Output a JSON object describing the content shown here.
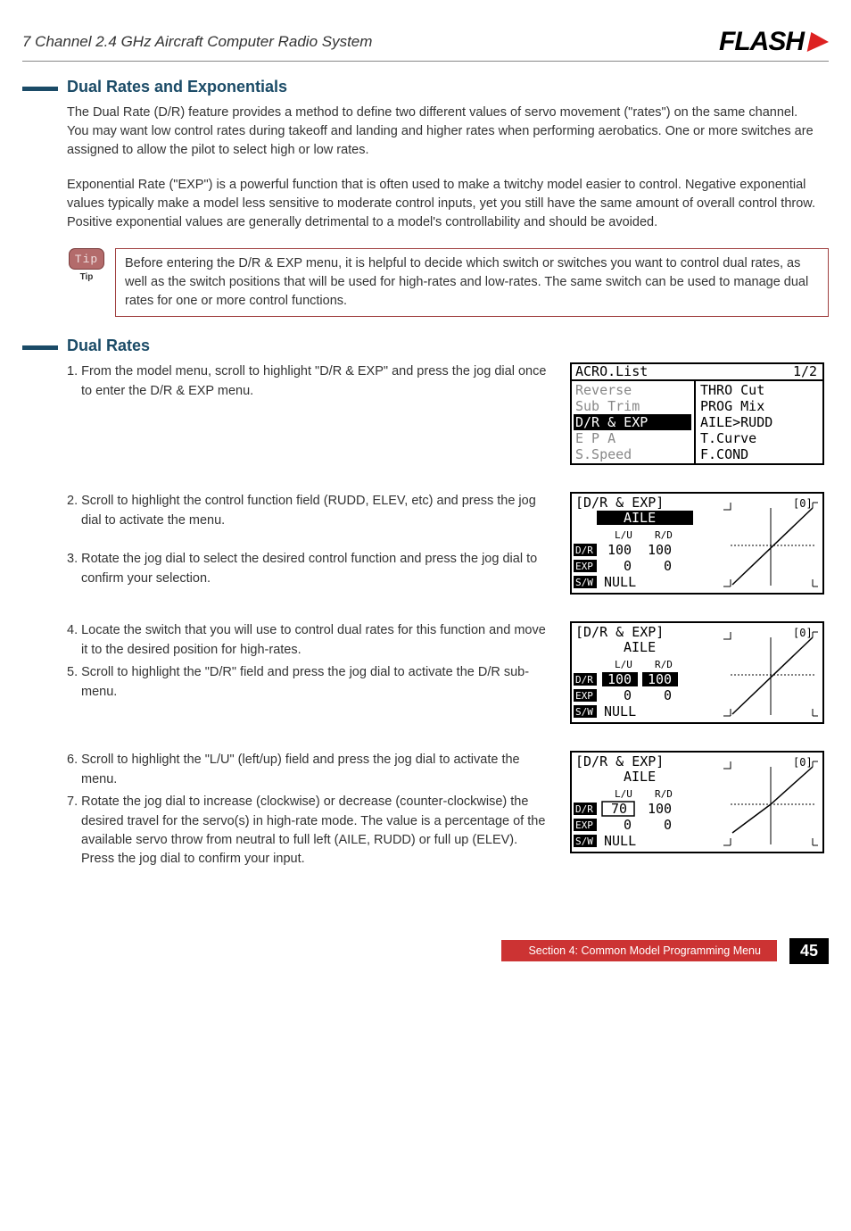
{
  "header": {
    "title": "7 Channel 2.4 GHz Aircraft Computer Radio System",
    "logo_text": "FLASH"
  },
  "section1": {
    "heading": "Dual Rates and Exponentials",
    "para1": "The Dual Rate (D/R) feature provides a method to define two different values of servo movement (\"rates\") on the same channel. You may want low control rates during takeoff and landing and higher rates when performing aerobatics. One or more switches are assigned to allow the pilot to select high or low rates.",
    "para2": "Exponential Rate (\"EXP\") is a powerful function that is often used to make a twitchy model easier to control. Negative exponential values typically make a model less sensitive to moderate control inputs, yet you still have the same amount of overall control throw. Positive exponential values are generally detrimental to a model's controllability and should be avoided."
  },
  "tip": {
    "badge": "Tip",
    "label": "Tip",
    "text": "Before entering the D/R & EXP menu, it is helpful to decide which switch or switches you want to control dual rates, as well as the switch positions that will be used for high-rates and low-rates. The same switch can be used to manage dual rates for one or more control functions."
  },
  "section2": {
    "heading": "Dual Rates"
  },
  "steps": {
    "s1": "1. From the model menu, scroll to highlight \"D/R & EXP\" and press the jog dial once to enter the D/R & EXP menu.",
    "s2": "2. Scroll to highlight the control function field (RUDD, ELEV, etc) and press the jog dial to activate the menu.",
    "s3": "3. Rotate the jog dial to select the desired control function and press the jog dial to confirm your selection.",
    "s4": "4. Locate the switch that you will use to control dual rates for this function and move it to the desired position for high-rates.",
    "s5": "5. Scroll to highlight the \"D/R\" field and press the jog dial to activate the D/R sub-menu.",
    "s6": "6. Scroll to highlight the \"L/U\" (left/up) field and press the jog dial to activate the menu.",
    "s7": "7. Rotate the jog dial to increase (clockwise) or decrease (counter-clockwise) the desired travel for the servo(s) in high-rate mode. The value is a percentage of the available servo throw from neutral to full left (AILE, RUDD) or full up (ELEV). Press the jog dial to confirm your input."
  },
  "lcd1": {
    "title": "ACRO.List",
    "page": "1/2",
    "left": [
      "Reverse",
      "Sub Trim",
      "D/R & EXP",
      "E P A",
      "S.Speed"
    ],
    "right": [
      "THRO Cut",
      "PROG Mix",
      "AILE>RUDD",
      "T.Curve",
      "F.COND"
    ]
  },
  "lcd2": {
    "title": "[D/R & EXP]",
    "ch": "AILE",
    "c0": "[0]",
    "hL": "L/U",
    "hR": "R/D",
    "drL": "100",
    "drR": "100",
    "expL": "0",
    "expR": "0",
    "sw": "NULL",
    "labD": "D/R",
    "labE": "EXP",
    "labS": "S/W"
  },
  "lcd3": {
    "title": "[D/R & EXP]",
    "ch": "AILE",
    "c0": "[0]",
    "hL": "L/U",
    "hR": "R/D",
    "drL": "100",
    "drR": "100",
    "expL": "0",
    "expR": "0",
    "sw": "NULL",
    "labD": "D/R",
    "labE": "EXP",
    "labS": "S/W"
  },
  "lcd4": {
    "title": "[D/R & EXP]",
    "ch": "AILE",
    "c0": "[0]",
    "hL": "L/U",
    "hR": "R/D",
    "drL": "70",
    "drR": "100",
    "expL": "0",
    "expR": "0",
    "sw": "NULL",
    "labD": "D/R",
    "labE": "EXP",
    "labS": "S/W"
  },
  "footer": {
    "section": "Section 4: Common Model Programming Menu",
    "page": "45"
  }
}
